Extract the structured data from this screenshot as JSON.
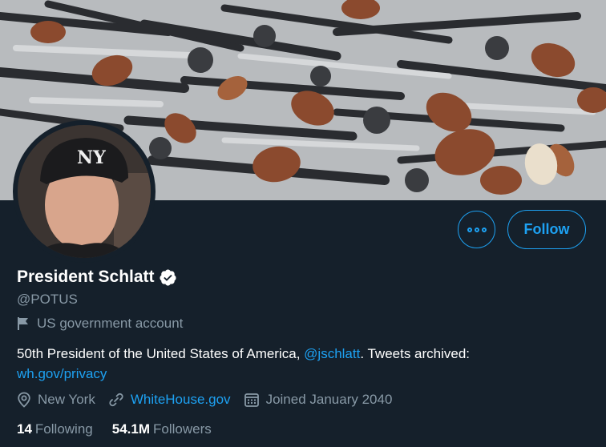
{
  "profile": {
    "name": "President Schlatt",
    "handle": "@POTUS",
    "account_label": "US government account",
    "bio_prefix": "50th President of the United States of America, ",
    "bio_mention": "@jschlatt",
    "bio_suffix": ". Tweets archived:",
    "bio_link": "wh.gov/privacy",
    "location": "New York",
    "website": "WhiteHouse.gov",
    "joined": "Joined January 2040",
    "following_count": "14",
    "following_label": "Following",
    "followers_count": "54.1M",
    "followers_label": "Followers"
  },
  "actions": {
    "follow_label": "Follow"
  },
  "colors": {
    "background": "#15202b",
    "accent": "#1da1f2",
    "muted_text": "#8899a6"
  },
  "icons": {
    "more": "more-icon",
    "verified": "verified-badge-icon",
    "flag": "flag-icon",
    "location": "location-pin-icon",
    "link": "link-icon",
    "calendar": "calendar-icon"
  }
}
